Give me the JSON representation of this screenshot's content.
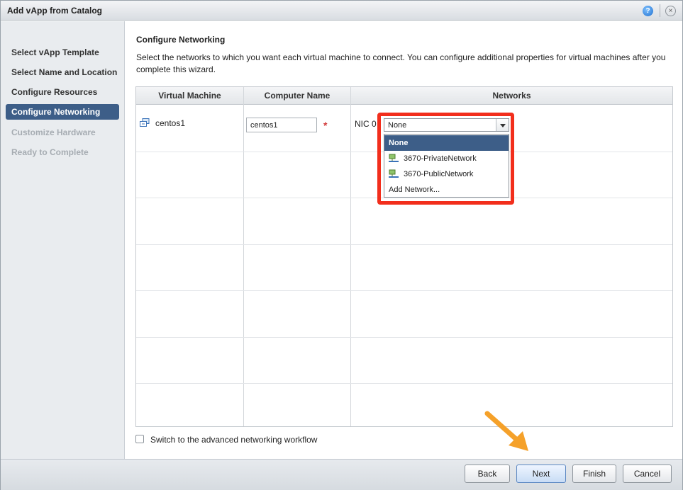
{
  "window": {
    "title": "Add vApp from Catalog"
  },
  "sidebar": {
    "steps": [
      {
        "label": "Select vApp Template"
      },
      {
        "label": "Select Name and Location"
      },
      {
        "label": "Configure Resources"
      },
      {
        "label": "Configure Networking"
      },
      {
        "label": "Customize Hardware"
      },
      {
        "label": "Ready to Complete"
      }
    ]
  },
  "main": {
    "heading": "Configure Networking",
    "description": "Select the networks to which you want each virtual machine to connect. You can configure additional properties for virtual machines after you complete this wizard.",
    "columns": {
      "vm": "Virtual Machine",
      "computer": "Computer Name",
      "networks": "Networks"
    },
    "row": {
      "vm_name": "centos1",
      "computer_name": "centos1",
      "required_mark": "*",
      "nic_label": "NIC 0",
      "selected_network": "None"
    },
    "network_options": [
      {
        "label": "None"
      },
      {
        "label": "3670-PrivateNetwork"
      },
      {
        "label": "3670-PublicNetwork"
      },
      {
        "label": "Add Network..."
      }
    ],
    "advanced_workflow_label": "Switch to the advanced networking workflow"
  },
  "footer": {
    "back": "Back",
    "next": "Next",
    "finish": "Finish",
    "cancel": "Cancel"
  },
  "colors": {
    "active_step": "#3d5e88",
    "highlight": "#f22e1c",
    "annotation": "#f5a12a"
  }
}
